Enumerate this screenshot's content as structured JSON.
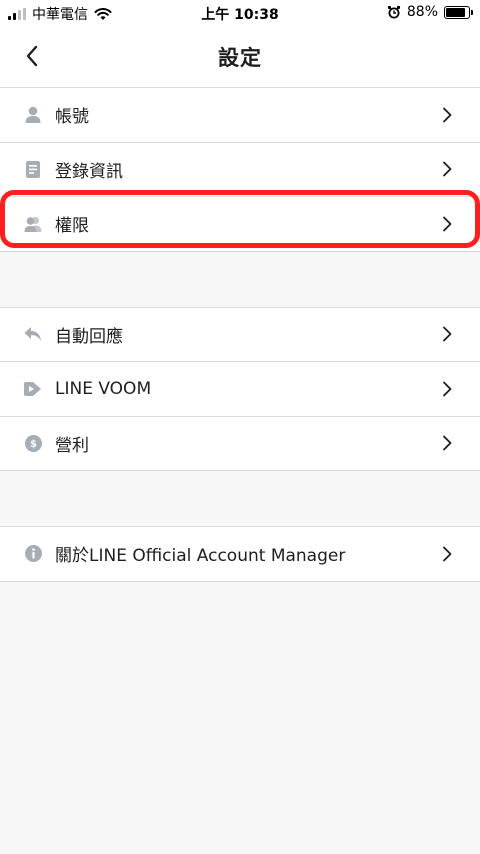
{
  "status_bar": {
    "carrier": "中華電信",
    "time": "上午 10:38",
    "battery_percent": "88%",
    "battery_level": 0.88,
    "icons": [
      "cellular-signal-icon",
      "wifi-icon",
      "alarm-icon",
      "battery-icon"
    ]
  },
  "nav": {
    "title": "設定",
    "back_icon": "chevron-left-icon"
  },
  "groups": [
    {
      "items": [
        {
          "label": "帳號",
          "icon": "person-icon"
        },
        {
          "label": "登錄資訊",
          "icon": "document-icon"
        },
        {
          "label": "權限",
          "icon": "people-icon",
          "highlighted": true
        }
      ]
    },
    {
      "items": [
        {
          "label": "自動回應",
          "icon": "reply-icon"
        },
        {
          "label": "LINE VOOM",
          "icon": "voom-icon"
        },
        {
          "label": "營利",
          "icon": "dollar-coin-icon"
        }
      ]
    },
    {
      "items": [
        {
          "label": "關於LINE Official Account Manager",
          "icon": "info-icon"
        }
      ]
    }
  ],
  "colors": {
    "background": "#f7f7f7",
    "row_background": "#ffffff",
    "divider": "#dcdcdc",
    "icon_gray": "#a7adb5",
    "highlight": "#ff1f1f"
  }
}
